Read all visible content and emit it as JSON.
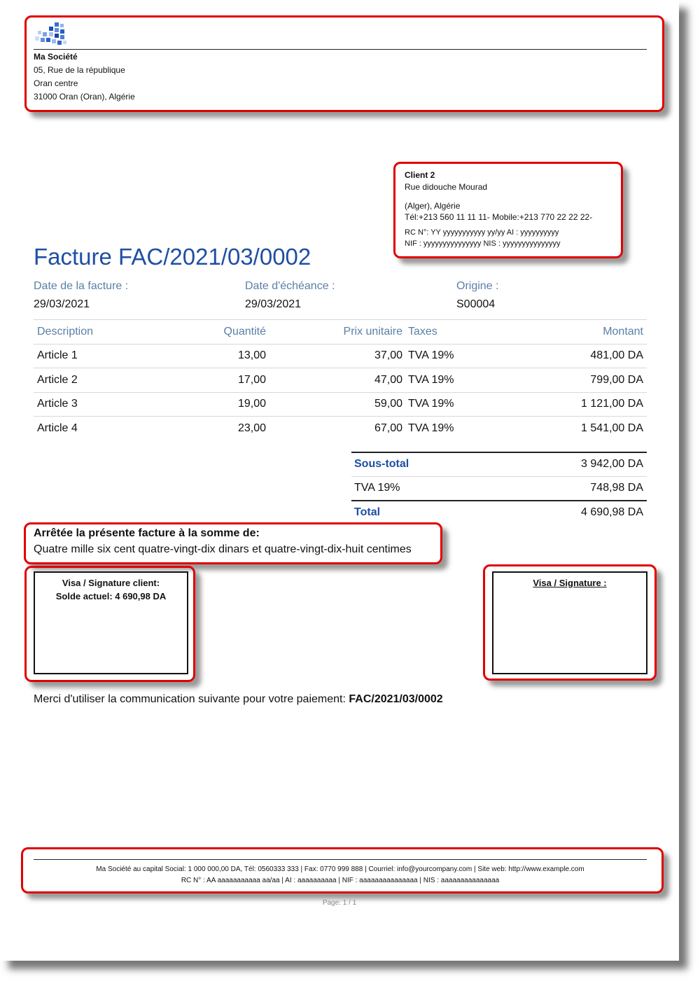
{
  "company": {
    "name": "Ma Société",
    "address_line1": "05, Rue de la république",
    "address_line2": "Oran centre",
    "address_line3": "31000 Oran (Oran), Algérie"
  },
  "client": {
    "name": "Client 2",
    "street": "Rue didouche Mourad",
    "city": "(Alger), Algérie",
    "phones": "Tél:+213 560 11 11 11- Mobile:+213 770 22 22 22-",
    "rc_ai": "RC N°: YY yyyyyyyyyyy yy/yy AI : yyyyyyyyyy",
    "nif_nis": "NIF : yyyyyyyyyyyyyyy NIS : yyyyyyyyyyyyyyy"
  },
  "invoice": {
    "title": "Facture FAC/2021/03/0002",
    "date_label": "Date de la facture :",
    "date_value": "29/03/2021",
    "due_label": "Date d'échéance :",
    "due_value": "29/03/2021",
    "origin_label": "Origine :",
    "origin_value": "S00004"
  },
  "table": {
    "headers": {
      "description": "Description",
      "quantity": "Quantité",
      "unit_price": "Prix unitaire",
      "taxes": "Taxes",
      "amount": "Montant"
    },
    "rows": [
      {
        "description": "Article 1",
        "quantity": "13,00",
        "unit_price": "37,00",
        "taxes": "TVA 19%",
        "amount": "481,00 DA"
      },
      {
        "description": "Article 2",
        "quantity": "17,00",
        "unit_price": "47,00",
        "taxes": "TVA 19%",
        "amount": "799,00 DA"
      },
      {
        "description": "Article 3",
        "quantity": "19,00",
        "unit_price": "59,00",
        "taxes": "TVA 19%",
        "amount": "1 121,00 DA"
      },
      {
        "description": "Article 4",
        "quantity": "23,00",
        "unit_price": "67,00",
        "taxes": "TVA 19%",
        "amount": "1 541,00 DA"
      }
    ]
  },
  "totals": {
    "subtotal_label": "Sous-total",
    "subtotal_value": "3 942,00 DA",
    "tax_label": "TVA 19%",
    "tax_value": "748,98 DA",
    "total_label": "Total",
    "total_value": "4 690,98 DA"
  },
  "amount_words": {
    "heading": "Arrêtée la présente facture à la somme de:",
    "text": "Quatre mille six cent quatre-vingt-dix dinars et quatre-vingt-dix-huit centimes"
  },
  "signature_client": {
    "title": "Visa / Signature client:",
    "balance": "Solde actuel: 4 690,98 DA"
  },
  "signature_company": {
    "title": "Visa / Signature :"
  },
  "payment": {
    "text": "Merci d'utiliser la communication suivante pour votre paiement: ",
    "reference": "FAC/2021/03/0002"
  },
  "footer": {
    "line1": "Ma Société au capital Social: 1 000 000,00 DA, Tél: 0560333 333 | Fax: 0770 999 888 | Courriel: info@yourcompany.com | Site web: http://www.example.com",
    "line2": "RC N° : AA aaaaaaaaaaa aa/aa | AI : aaaaaaaaaa | NIF : aaaaaaaaaaaaaaa | NIS : aaaaaaaaaaaaaaa",
    "page": "Page: 1 / 1"
  },
  "colors": {
    "title_blue": "#1f4fa3",
    "label_blue": "#5b7fa6",
    "highlight_red": "#e00000"
  }
}
